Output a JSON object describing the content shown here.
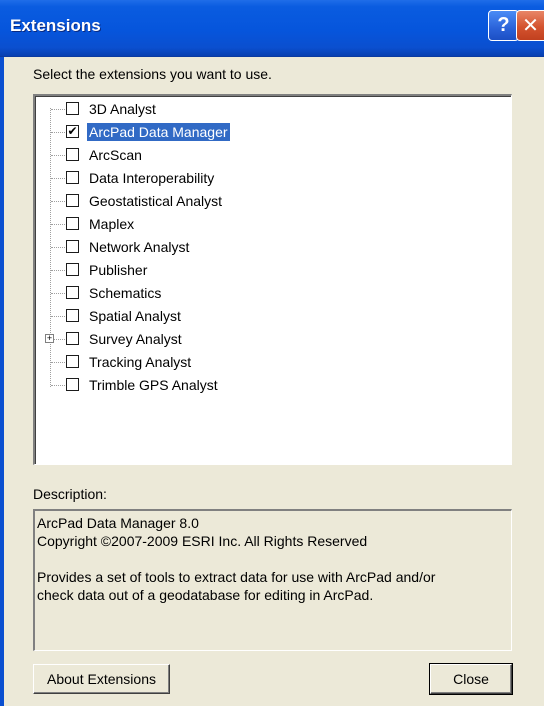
{
  "window": {
    "title": "Extensions",
    "help_glyph": "?",
    "close_glyph": "✕"
  },
  "instruction": "Select the extensions you want to use.",
  "extensions": [
    {
      "label": "3D Analyst",
      "checked": false,
      "selected": false,
      "expandable": false
    },
    {
      "label": "ArcPad Data Manager",
      "checked": true,
      "selected": true,
      "expandable": false
    },
    {
      "label": "ArcScan",
      "checked": false,
      "selected": false,
      "expandable": false
    },
    {
      "label": "Data Interoperability",
      "checked": false,
      "selected": false,
      "expandable": false
    },
    {
      "label": "Geostatistical Analyst",
      "checked": false,
      "selected": false,
      "expandable": false
    },
    {
      "label": "Maplex",
      "checked": false,
      "selected": false,
      "expandable": false
    },
    {
      "label": "Network Analyst",
      "checked": false,
      "selected": false,
      "expandable": false
    },
    {
      "label": "Publisher",
      "checked": false,
      "selected": false,
      "expandable": false
    },
    {
      "label": "Schematics",
      "checked": false,
      "selected": false,
      "expandable": false
    },
    {
      "label": "Spatial Analyst",
      "checked": false,
      "selected": false,
      "expandable": false
    },
    {
      "label": "Survey Analyst",
      "checked": false,
      "selected": false,
      "expandable": true
    },
    {
      "label": "Tracking Analyst",
      "checked": false,
      "selected": false,
      "expandable": false
    },
    {
      "label": "Trimble GPS Analyst",
      "checked": false,
      "selected": false,
      "expandable": false
    }
  ],
  "description": {
    "label": "Description:",
    "line1": "ArcPad Data Manager 8.0",
    "line2": "Copyright ©2007-2009 ESRI Inc. All Rights Reserved",
    "line3": "Provides a set of tools to extract data for use with ArcPad and/or",
    "line4": "check data out of a geodatabase for editing in ArcPad."
  },
  "buttons": {
    "about": "About Extensions",
    "close": "Close"
  },
  "colors": {
    "titlebar": "#0655dc",
    "selection": "#316ac5",
    "dialog_bg": "#ece9d8"
  },
  "icons": {
    "check": "✔",
    "expand": "+"
  }
}
